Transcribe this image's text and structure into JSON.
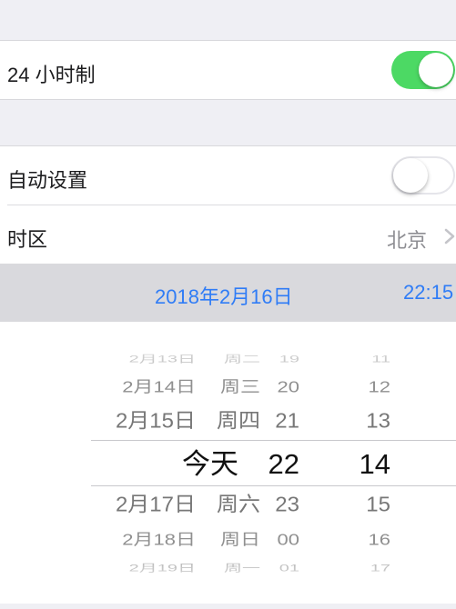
{
  "settings": {
    "clock24": {
      "label": "24 小时制",
      "on": true
    },
    "auto_set": {
      "label": "自动设置",
      "on": false
    },
    "timezone": {
      "label": "时区",
      "value": "北京"
    }
  },
  "datetime": {
    "date": "2018年2月16日",
    "time": "22:15"
  },
  "picker": {
    "rows": [
      {
        "date": "2月13日",
        "weekday": "周二",
        "hour": "19",
        "minute": "11"
      },
      {
        "date": "2月14日",
        "weekday": "周三",
        "hour": "20",
        "minute": "12"
      },
      {
        "date": "2月15日",
        "weekday": "周四",
        "hour": "21",
        "minute": "13"
      },
      {
        "date": "今天",
        "weekday": "",
        "hour": "22",
        "minute": "14"
      },
      {
        "date": "2月17日",
        "weekday": "周六",
        "hour": "23",
        "minute": "15"
      },
      {
        "date": "2月18日",
        "weekday": "周日",
        "hour": "00",
        "minute": "16"
      },
      {
        "date": "2月19日",
        "weekday": "周一",
        "hour": "01",
        "minute": "17"
      }
    ]
  },
  "colors": {
    "toggle_on": "#4cd964",
    "link_blue": "#2f7cf6",
    "background": "#efeff4"
  }
}
